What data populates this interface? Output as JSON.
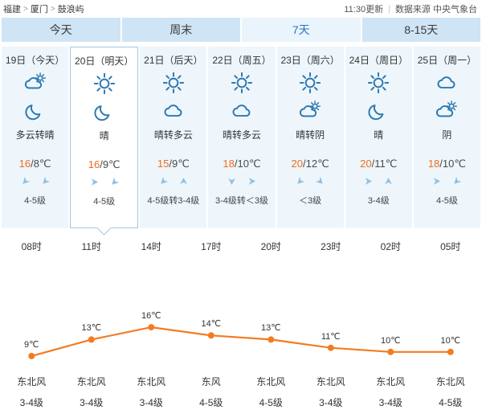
{
  "header": {
    "breadcrumb": [
      "福建",
      "厦门",
      "鼓浪屿"
    ],
    "separator": ">",
    "update_time": "11:30更新",
    "divider": "|",
    "source": "数据来源 中央气象台"
  },
  "tabs": [
    {
      "label": "今天",
      "active": false
    },
    {
      "label": "周末",
      "active": false
    },
    {
      "label": "7天",
      "active": true
    },
    {
      "label": "8-15天",
      "active": false
    }
  ],
  "colors": {
    "tab_bg": "#cfe4f5",
    "tab_active_bg": "#eaf4fd",
    "tab_active_text": "#2a73c5",
    "card_bg": "#eef6fc",
    "card_selected_border": "#9dc8e8",
    "icon_blue": "#2e7ab0",
    "wind_arrow": "#8ec0e4",
    "high_temp": "#f06c1e",
    "line": "#f47b20"
  },
  "days": [
    {
      "date": "19日（今天）",
      "day_icon": "cloud-sun-icon",
      "night_icon": "moon-icon",
      "condition": "多云转晴",
      "high": "16",
      "sep": "/",
      "low": "8℃",
      "wind_arrows": [
        "ne",
        "ne"
      ],
      "wind_level": "4-5级",
      "selected": false
    },
    {
      "date": "20日（明天）",
      "day_icon": "sun-icon",
      "night_icon": "moon-icon",
      "condition": "晴",
      "high": "16",
      "sep": "/",
      "low": "9℃",
      "wind_arrows": [
        "w",
        "ne"
      ],
      "wind_level": "4-5级",
      "selected": true
    },
    {
      "date": "21日（后天）",
      "day_icon": "sun-icon",
      "night_icon": "cloud-icon",
      "condition": "晴转多云",
      "high": "15",
      "sep": "/",
      "low": "9℃",
      "wind_arrows": [
        "ne",
        "s"
      ],
      "wind_level": "4-5级转3-4级",
      "selected": false
    },
    {
      "date": "22日（周五）",
      "day_icon": "sun-icon",
      "night_icon": "cloud-icon",
      "condition": "晴转多云",
      "high": "18",
      "sep": "/",
      "low": "10℃",
      "wind_arrows": [
        "n",
        "w"
      ],
      "wind_level": "3-4级转＜3级",
      "selected": false
    },
    {
      "date": "23日（周六）",
      "day_icon": "sun-icon",
      "night_icon": "cloud-sun-icon",
      "condition": "晴转阴",
      "high": "20",
      "sep": "/",
      "low": "12℃",
      "wind_arrows": [
        "ne",
        "nw"
      ],
      "wind_level": "＜3级",
      "selected": false
    },
    {
      "date": "24日（周日）",
      "day_icon": "sun-icon",
      "night_icon": "moon-icon",
      "condition": "晴",
      "high": "20",
      "sep": "/",
      "low": "11℃",
      "wind_arrows": [
        "w",
        "s"
      ],
      "wind_level": "3-4级",
      "selected": false
    },
    {
      "date": "25日（周一）",
      "day_icon": "cloud-icon",
      "night_icon": "cloud-sun-icon",
      "condition": "阴",
      "high": "18",
      "sep": "/",
      "low": "10℃",
      "wind_arrows": [
        "w",
        "ne"
      ],
      "wind_level": "4-5级",
      "selected": false
    }
  ],
  "chart_data": {
    "type": "line",
    "title": "",
    "xlabel": "",
    "ylabel": "",
    "categories": [
      "08时",
      "11时",
      "14时",
      "17时",
      "20时",
      "23时",
      "02时",
      "05时"
    ],
    "values": [
      9,
      13,
      16,
      14,
      13,
      11,
      10,
      10
    ],
    "labels": [
      "9℃",
      "13℃",
      "16℃",
      "14℃",
      "13℃",
      "11℃",
      "10℃",
      "10℃"
    ],
    "point_icons": [
      "sun-icon",
      "sun-icon",
      "sun-icon",
      "sun-icon",
      "moon-icon",
      "moon-icon",
      "moon-icon",
      "moon-icon"
    ],
    "ylim": [
      8,
      17
    ],
    "grid": false,
    "legend": "none",
    "line_color": "#f47b20",
    "point_color": "#f47b20"
  },
  "hourly_wind": [
    {
      "direction": "东北风",
      "level": "3-4级"
    },
    {
      "direction": "东北风",
      "level": "3-4级"
    },
    {
      "direction": "东北风",
      "level": "3-4级"
    },
    {
      "direction": "东风",
      "level": "4-5级"
    },
    {
      "direction": "东北风",
      "level": "4-5级"
    },
    {
      "direction": "东北风",
      "level": "3-4级"
    },
    {
      "direction": "东北风",
      "level": "3-4级"
    },
    {
      "direction": "东北风",
      "level": "4-5级"
    }
  ]
}
